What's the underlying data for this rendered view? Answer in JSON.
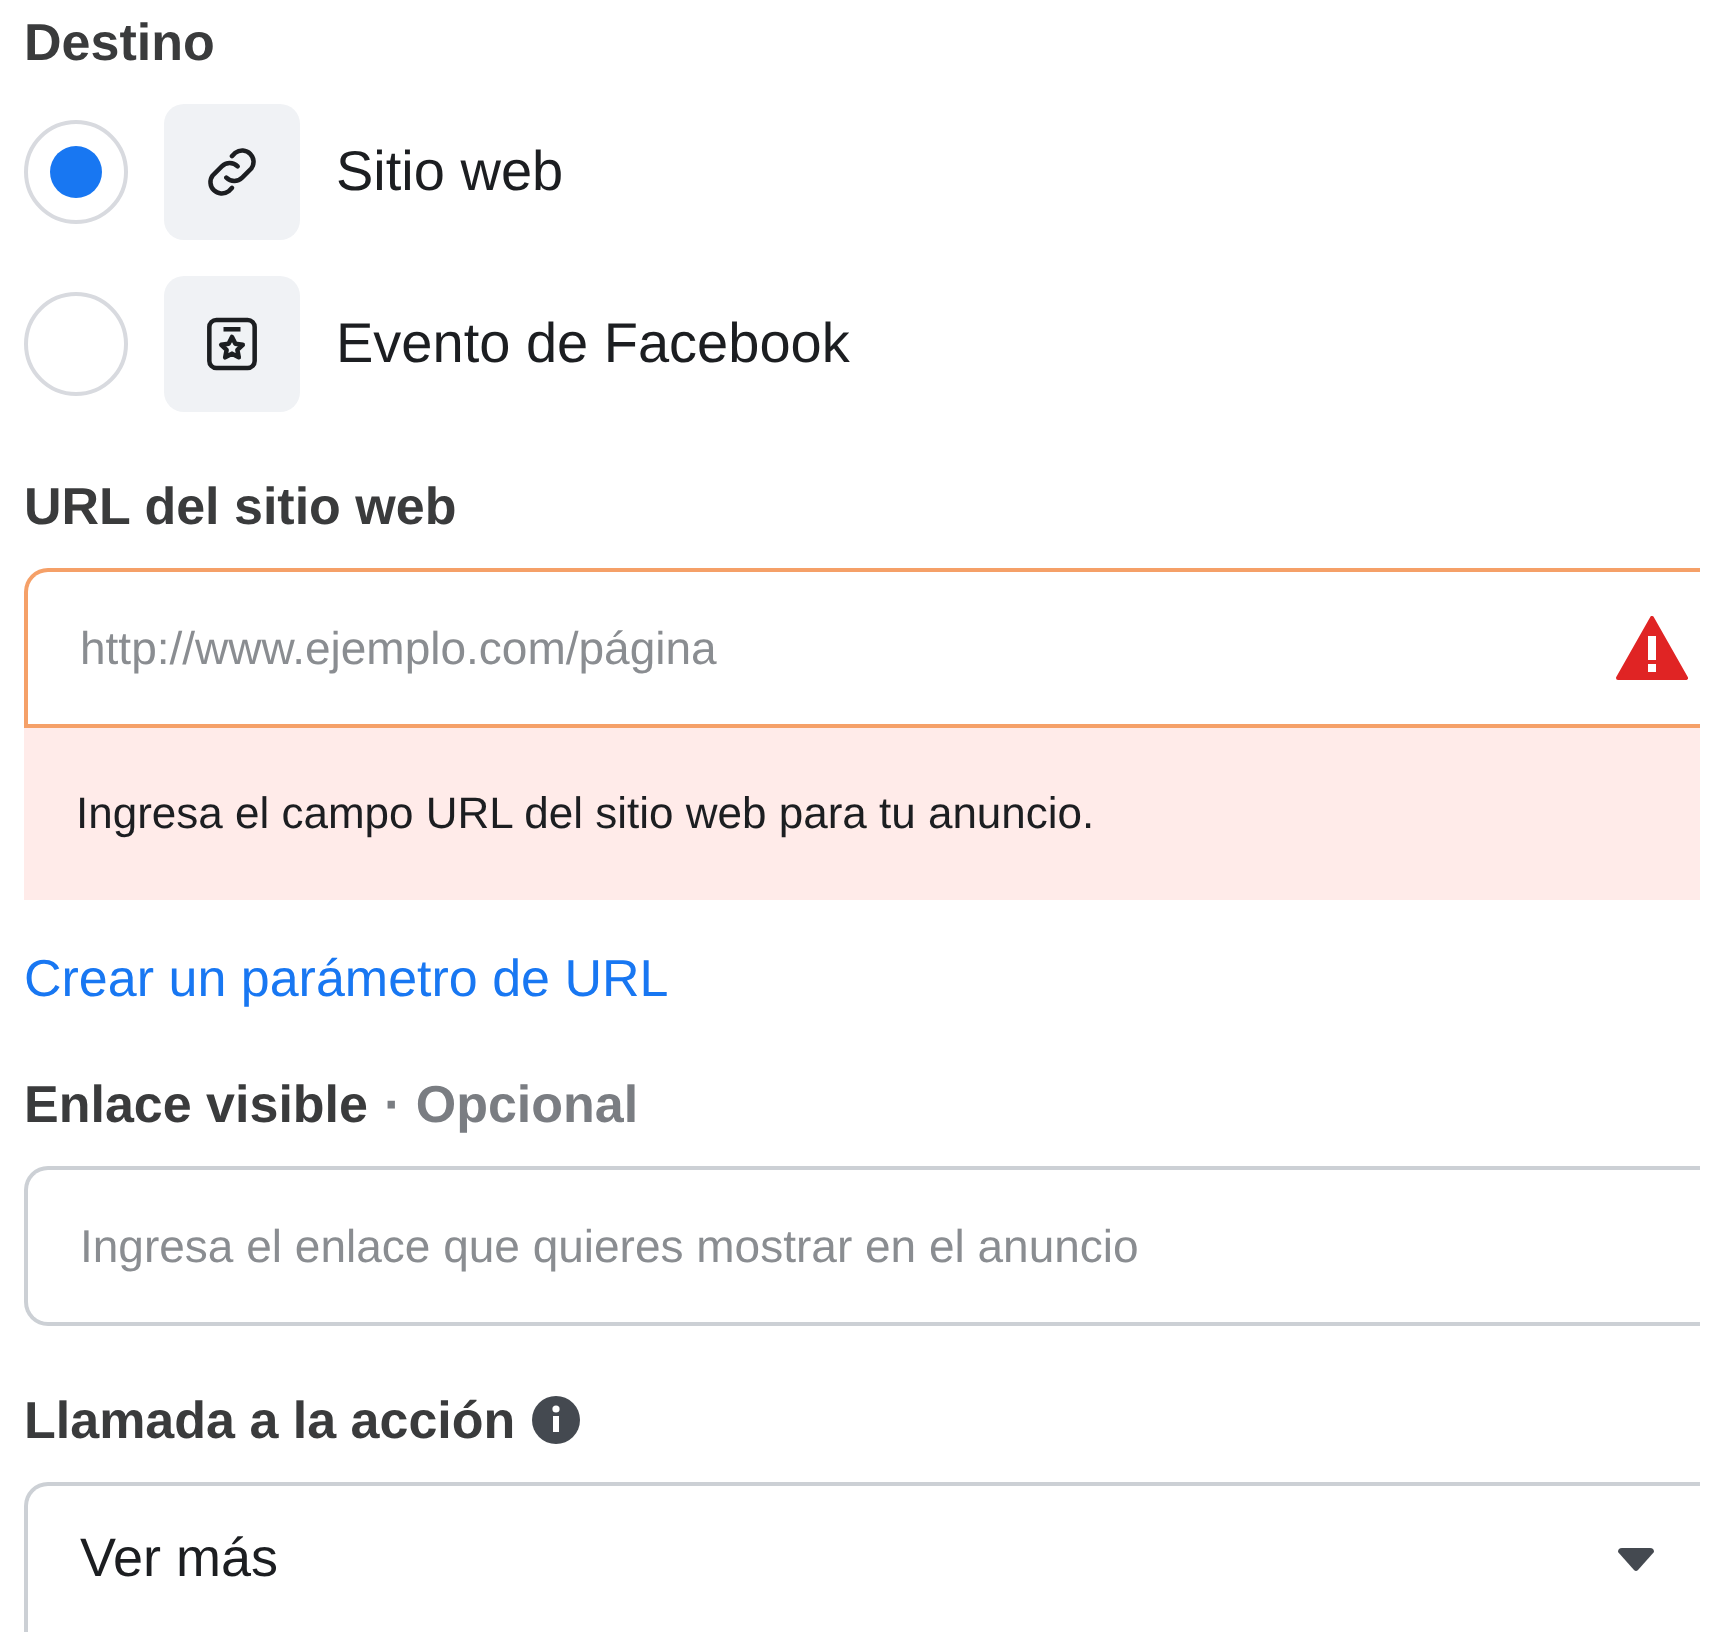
{
  "destination": {
    "heading": "Destino",
    "options": [
      {
        "label": "Sitio web",
        "kind": "link",
        "selected": true
      },
      {
        "label": "Evento de Facebook",
        "kind": "event",
        "selected": false
      }
    ]
  },
  "website_url": {
    "label": "URL del sitio web",
    "placeholder": "http://www.ejemplo.com/página",
    "invalid": true,
    "error": "Ingresa el campo URL del sitio web para tu anuncio."
  },
  "url_parameter_link": "Crear un parámetro de URL",
  "display_link": {
    "label": "Enlace visible",
    "optional": "· Opcional",
    "placeholder": "Ingresa el enlace que quieres mostrar en el anuncio"
  },
  "call_to_action": {
    "label": "Llamada a la acción",
    "value": "Ver más"
  }
}
